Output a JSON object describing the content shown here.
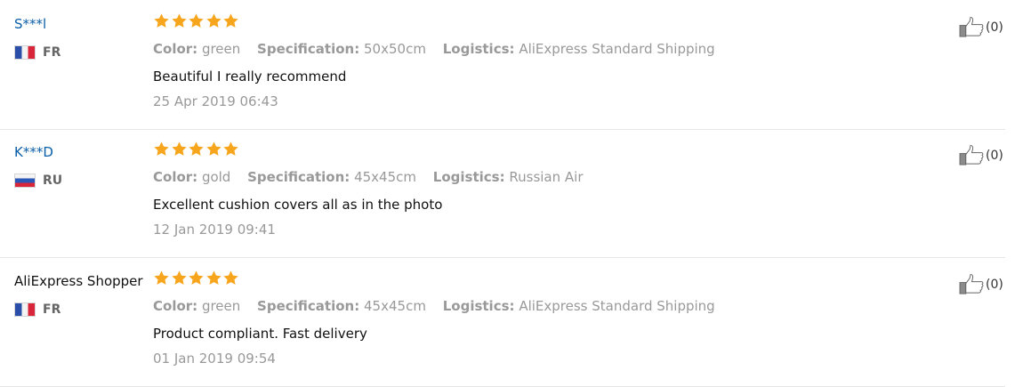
{
  "labels": {
    "color": "Color:",
    "specification": "Specification:",
    "logistics": "Logistics:"
  },
  "colors": {
    "star": "#f8a51e",
    "username_link": "#0b5ea8",
    "meta_gray": "#999999"
  },
  "reviews": [
    {
      "user": "S***l",
      "country": "FR",
      "flag": "fr-flag-icon",
      "rating": 5,
      "color": "green",
      "specification": "50x50cm",
      "logistics": "AliExpress Standard Shipping",
      "text": "Beautiful I really recommend",
      "date": "25 Apr 2019 06:43",
      "helpful_count": "(0)"
    },
    {
      "user": "K***D",
      "country": "RU",
      "flag": "ru-flag-icon",
      "rating": 5,
      "color": "gold",
      "specification": "45x45cm",
      "logistics": "Russian Air",
      "text": "Excellent cushion covers all as in the photo",
      "date": "12 Jan 2019 09:41",
      "helpful_count": "(0)"
    },
    {
      "user": "AliExpress Shopper",
      "country": "FR",
      "flag": "fr-flag-icon",
      "rating": 5,
      "color": "green",
      "specification": "45x45cm",
      "logistics": "AliExpress Standard Shipping",
      "text": "Product compliant. Fast delivery",
      "date": "01 Jan 2019 09:54",
      "helpful_count": "(0)"
    }
  ]
}
